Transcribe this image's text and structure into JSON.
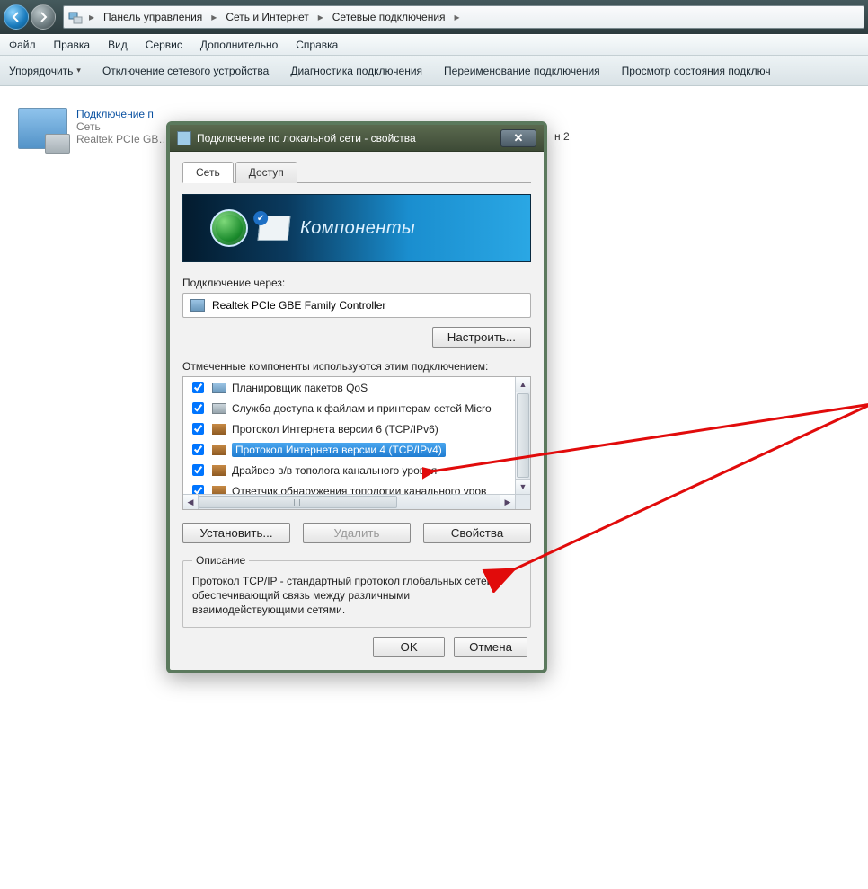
{
  "addressbar": {
    "segments": [
      "Панель управления",
      "Сеть и Интернет",
      "Сетевые подключения"
    ]
  },
  "menubar": {
    "file": "Файл",
    "edit": "Правка",
    "view": "Вид",
    "service": "Сервис",
    "advanced": "Дополнительно",
    "help": "Справка"
  },
  "toolbar": {
    "organize": "Упорядочить",
    "disable": "Отключение сетевого устройства",
    "diagnose": "Диагностика подключения",
    "rename": "Переименование подключения",
    "status": "Просмотр состояния подключ"
  },
  "explorer": {
    "conn_name": "Подключение п",
    "conn_net": "Сеть",
    "conn_adapter": "Realtek PCIe GB…",
    "conn2_suffix": "н 2"
  },
  "dialog": {
    "title": "Подключение по локальной сети - свойства",
    "tab_net": "Сеть",
    "tab_access": "Доступ",
    "banner_text": "Компоненты",
    "connect_via_label": "Подключение через:",
    "adapter": "Realtek PCIe GBE Family Controller",
    "configure_btn": "Настроить...",
    "components_label": "Отмеченные компоненты используются этим подключением:",
    "components": [
      {
        "checked": true,
        "icon": "qos",
        "label": "Планировщик пакетов QoS"
      },
      {
        "checked": true,
        "icon": "svc",
        "label": "Служба доступа к файлам и принтерам сетей Micro"
      },
      {
        "checked": true,
        "icon": "net",
        "label": "Протокол Интернета версии 6 (TCP/IPv6)"
      },
      {
        "checked": true,
        "icon": "net",
        "label": "Протокол Интернета версии 4 (TCP/IPv4)",
        "selected": true
      },
      {
        "checked": true,
        "icon": "net",
        "label": "Драйвер в/в тополога канального уровня"
      },
      {
        "checked": true,
        "icon": "net",
        "label": "Ответчик обнаружения топологии канального уров"
      }
    ],
    "install_btn": "Установить...",
    "remove_btn": "Удалить",
    "props_btn": "Свойства",
    "desc_legend": "Описание",
    "desc_text": "Протокол TCP/IP - стандартный протокол глобальных сетей, обеспечивающий связь между различными взаимодействующими сетями.",
    "ok": "OK",
    "cancel": "Отмена"
  }
}
